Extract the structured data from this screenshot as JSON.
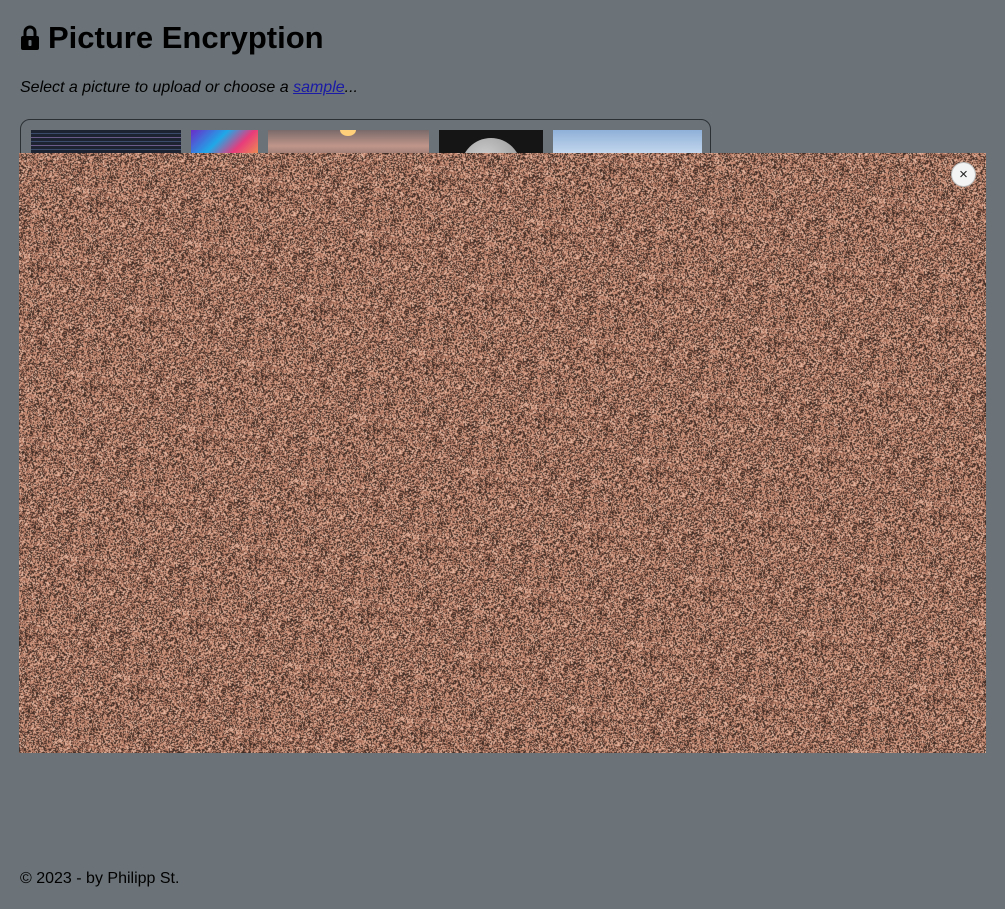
{
  "header": {
    "title": "Picture Encryption",
    "icon": "lock-icon"
  },
  "intro": {
    "prefix": "Select a picture to upload or choose a ",
    "link": "sample",
    "suffix": "..."
  },
  "samples": [
    {
      "name": "code-screenshot"
    },
    {
      "name": "colorful-swirl"
    },
    {
      "name": "sunset-mountains"
    },
    {
      "name": "moon"
    },
    {
      "name": "forest-landscape"
    }
  ],
  "modal": {
    "close_label": "×",
    "image": "encrypted-noise-image",
    "colors": {
      "base": "#c08670",
      "speckle_dark": "#3a2a22",
      "speckle_light": "#e8b7a0"
    }
  },
  "footer": {
    "text": "© 2023 - by Philipp St."
  }
}
